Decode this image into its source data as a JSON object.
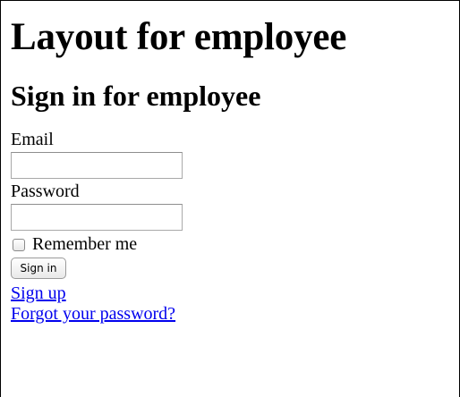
{
  "page": {
    "title": "Layout for employee"
  },
  "form": {
    "heading": "Sign in for employee",
    "email_label": "Email",
    "email_value": "",
    "password_label": "Password",
    "password_value": "",
    "remember_label": "Remember me",
    "remember_checked": false,
    "submit_label": "Sign in"
  },
  "links": {
    "sign_up": "Sign up",
    "forgot_password": "Forgot your password?"
  },
  "colors": {
    "link": "#0000ee",
    "text": "#000000",
    "background": "#ffffff"
  }
}
